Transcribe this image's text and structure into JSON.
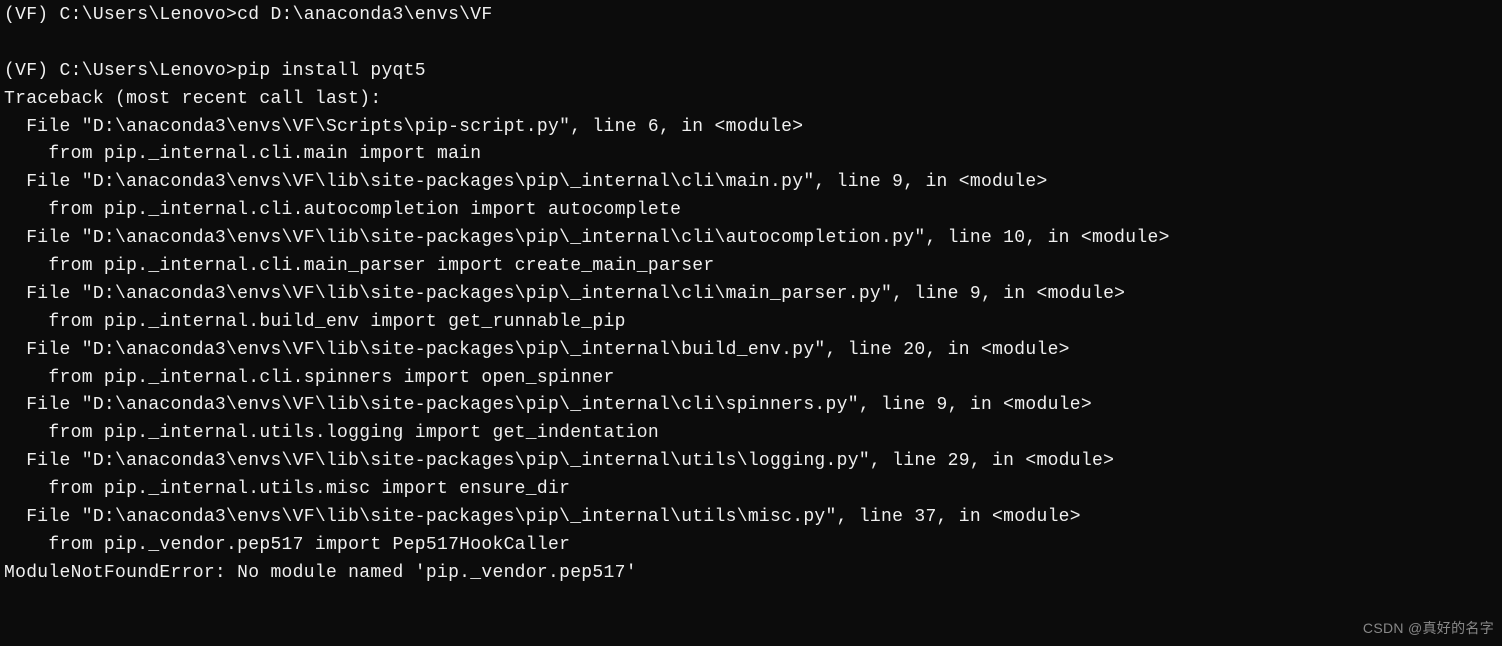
{
  "lines": [
    "(VF) C:\\Users\\Lenovo>cd D:\\anaconda3\\envs\\VF",
    "",
    "(VF) C:\\Users\\Lenovo>pip install pyqt5",
    "Traceback (most recent call last):",
    "  File \"D:\\anaconda3\\envs\\VF\\Scripts\\pip-script.py\", line 6, in <module>",
    "    from pip._internal.cli.main import main",
    "  File \"D:\\anaconda3\\envs\\VF\\lib\\site-packages\\pip\\_internal\\cli\\main.py\", line 9, in <module>",
    "    from pip._internal.cli.autocompletion import autocomplete",
    "  File \"D:\\anaconda3\\envs\\VF\\lib\\site-packages\\pip\\_internal\\cli\\autocompletion.py\", line 10, in <module>",
    "    from pip._internal.cli.main_parser import create_main_parser",
    "  File \"D:\\anaconda3\\envs\\VF\\lib\\site-packages\\pip\\_internal\\cli\\main_parser.py\", line 9, in <module>",
    "    from pip._internal.build_env import get_runnable_pip",
    "  File \"D:\\anaconda3\\envs\\VF\\lib\\site-packages\\pip\\_internal\\build_env.py\", line 20, in <module>",
    "    from pip._internal.cli.spinners import open_spinner",
    "  File \"D:\\anaconda3\\envs\\VF\\lib\\site-packages\\pip\\_internal\\cli\\spinners.py\", line 9, in <module>",
    "    from pip._internal.utils.logging import get_indentation",
    "  File \"D:\\anaconda3\\envs\\VF\\lib\\site-packages\\pip\\_internal\\utils\\logging.py\", line 29, in <module>",
    "    from pip._internal.utils.misc import ensure_dir",
    "  File \"D:\\anaconda3\\envs\\VF\\lib\\site-packages\\pip\\_internal\\utils\\misc.py\", line 37, in <module>",
    "    from pip._vendor.pep517 import Pep517HookCaller",
    "ModuleNotFoundError: No module named 'pip._vendor.pep517'"
  ],
  "watermark": "CSDN @真好的名字"
}
